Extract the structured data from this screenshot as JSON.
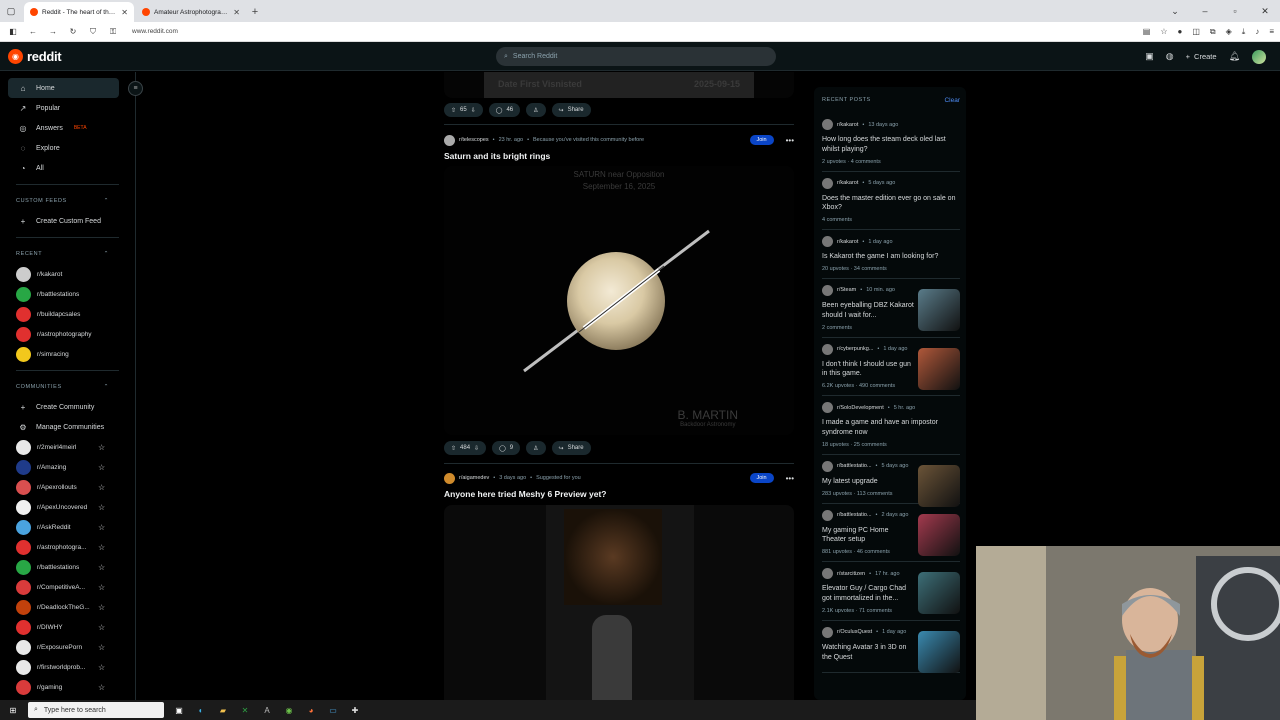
{
  "browser": {
    "tabs": [
      {
        "label": "Reddit - The heart of the intern",
        "active": true
      },
      {
        "label": "Amateur Astrophotography",
        "active": false
      }
    ],
    "url": "www.reddit.com"
  },
  "header": {
    "logo_text": "reddit",
    "search_placeholder": "Search Reddit",
    "create_label": "Create"
  },
  "sidebar": {
    "nav": [
      {
        "label": "Home",
        "icon": "home-icon",
        "glyph": "⌂"
      },
      {
        "label": "Popular",
        "icon": "popular-icon",
        "glyph": "↗"
      },
      {
        "label": "Answers",
        "icon": "answers-icon",
        "glyph": "◎",
        "badge": "BETA"
      },
      {
        "label": "Explore",
        "icon": "explore-icon",
        "glyph": "◌"
      },
      {
        "label": "All",
        "icon": "all-icon",
        "glyph": "◔"
      }
    ],
    "custom_feeds_header": "CUSTOM FEEDS",
    "create_custom_feed": "Create Custom Feed",
    "recent_header": "RECENT",
    "recent": [
      {
        "label": "r/kakarot",
        "color": "#cccccc"
      },
      {
        "label": "r/battlestations",
        "color": "#28a745"
      },
      {
        "label": "r/buildapcsales",
        "color": "#e0302f"
      },
      {
        "label": "r/astrophotography",
        "color": "#e0302f"
      },
      {
        "label": "r/simracing",
        "color": "#f2c81c"
      }
    ],
    "communities_header": "COMMUNITIES",
    "create_community": "Create Community",
    "manage_communities": "Manage Communities",
    "communities": [
      {
        "label": "r/2meirl4meirl",
        "color": "#e8e8e8"
      },
      {
        "label": "r/Amazing",
        "color": "#1f3b8a"
      },
      {
        "label": "r/Apexrollouts",
        "color": "#d94f4f"
      },
      {
        "label": "r/ApexUncovered",
        "color": "#f0f0f0"
      },
      {
        "label": "r/AskReddit",
        "color": "#4aa3df"
      },
      {
        "label": "r/astrophotogra...",
        "color": "#e0302f"
      },
      {
        "label": "r/battlestations",
        "color": "#28a745"
      },
      {
        "label": "r/CompetitiveA...",
        "color": "#d93b3b"
      },
      {
        "label": "r/DeadlockTheG...",
        "color": "#c2410c"
      },
      {
        "label": "r/DIWHY",
        "color": "#e0302f"
      },
      {
        "label": "r/ExposurePorn",
        "color": "#e8e8e8"
      },
      {
        "label": "r/firstworldprob...",
        "color": "#e8e8e8"
      },
      {
        "label": "r/gaming",
        "color": "#d93b3b"
      }
    ]
  },
  "feed": {
    "prev_post": {
      "image_caption_left": "Date First Visnisted",
      "image_caption_right": "2025-09-15",
      "votes": "65",
      "comments": "46",
      "share": "Share"
    },
    "posts": [
      {
        "subreddit": "r/telescopes",
        "time": "23 hr. ago",
        "reason": "Because you've visited this community before",
        "join": "Join",
        "title": "Saturn and its bright rings",
        "image_title": "SATURN near Opposition",
        "image_date": "September 16, 2025",
        "image_sign": "B. MARTIN",
        "image_sign_sub": "Backdoor Astronomy",
        "votes": "484",
        "comments": "9",
        "share": "Share"
      },
      {
        "subreddit": "r/aigamedev",
        "time": "3 days ago",
        "reason": "Suggested for you",
        "join": "Join",
        "title": "Anyone here tried Meshy 6 Preview yet?"
      }
    ]
  },
  "recent_posts": {
    "header": "RECENT POSTS",
    "clear": "Clear",
    "items": [
      {
        "sub": "r/kakarot",
        "time": "13 days ago",
        "title": "How long does the steam deck oled last whilst playing?",
        "stats": "2 upvotes · 4 comments"
      },
      {
        "sub": "r/kakarot",
        "time": "5 days ago",
        "title": "Does the master edition ever go on sale on Xbox?",
        "stats": "4 comments"
      },
      {
        "sub": "r/kakarot",
        "time": "1 day ago",
        "title": "Is Kakarot the game I am looking for?",
        "stats": "20 upvotes · 34 comments"
      },
      {
        "sub": "r/Steam",
        "time": "10 min. ago",
        "title": "Been eyeballing DBZ Kakarot should I wait for...",
        "stats": "2 comments",
        "thumb": "#5a7c8a"
      },
      {
        "sub": "r/cyberpunkg...",
        "time": "1 day ago",
        "title": "I don't think I should use gun in this game.",
        "stats": "6.2K upvotes · 490 comments",
        "thumb": "#b0583a"
      },
      {
        "sub": "r/SoloDevelopment",
        "time": "5 hr. ago",
        "title": "I made a game and have an impostor syndrome now",
        "stats": "18 upvotes · 25 comments"
      },
      {
        "sub": "r/battlestatio...",
        "time": "5 days ago",
        "title": "My latest upgrade",
        "stats": "283 upvotes · 113 comments",
        "thumb": "#6b5438"
      },
      {
        "sub": "r/battlestatio...",
        "time": "2 days ago",
        "title": "My gaming PC Home Theater setup",
        "stats": "881 upvotes · 46 comments",
        "thumb": "#a33a4e"
      },
      {
        "sub": "r/starcitizen",
        "time": "17 hr. ago",
        "title": "Elevator Guy / Cargo Chad got immortalized in the...",
        "stats": "2.1K upvotes · 71 comments",
        "thumb": "#3d6f78"
      },
      {
        "sub": "r/OculusQuest",
        "time": "1 day ago",
        "title": "Watching Avatar 3 in 3D on the Quest",
        "stats": "",
        "thumb": "#3a8ab0"
      }
    ]
  },
  "taskbar": {
    "search_placeholder": "Type here to search"
  }
}
